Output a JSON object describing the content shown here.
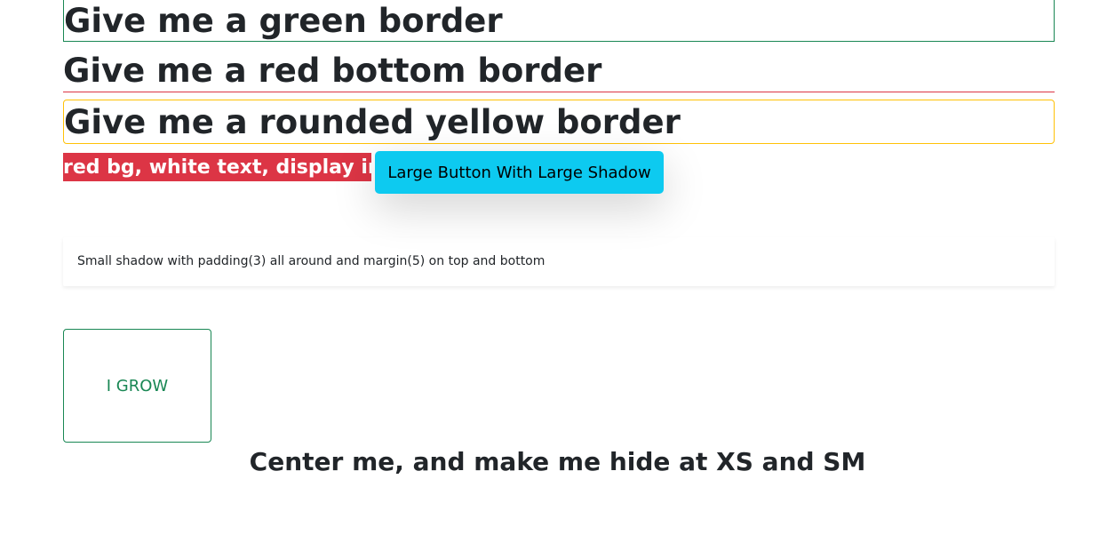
{
  "headings": {
    "green_border": "Give me a green border",
    "red_bottom_border": "Give me a red bottom border",
    "rounded_yellow_border": "Give me a rounded yellow border"
  },
  "inline_label": "red bg, white text, display inline",
  "large_button_label": "Large Button With Large Shadow",
  "shadow_box_text": "Small shadow with padding(3) all around and margin(5) on top and bottom",
  "grow_box_label": "I GROW",
  "center_heading": "Center me, and make me hide at XS and SM",
  "colors": {
    "green": "#198754",
    "red": "#dc3545",
    "yellow": "#ffc107",
    "cyan": "#0dcaf0"
  }
}
